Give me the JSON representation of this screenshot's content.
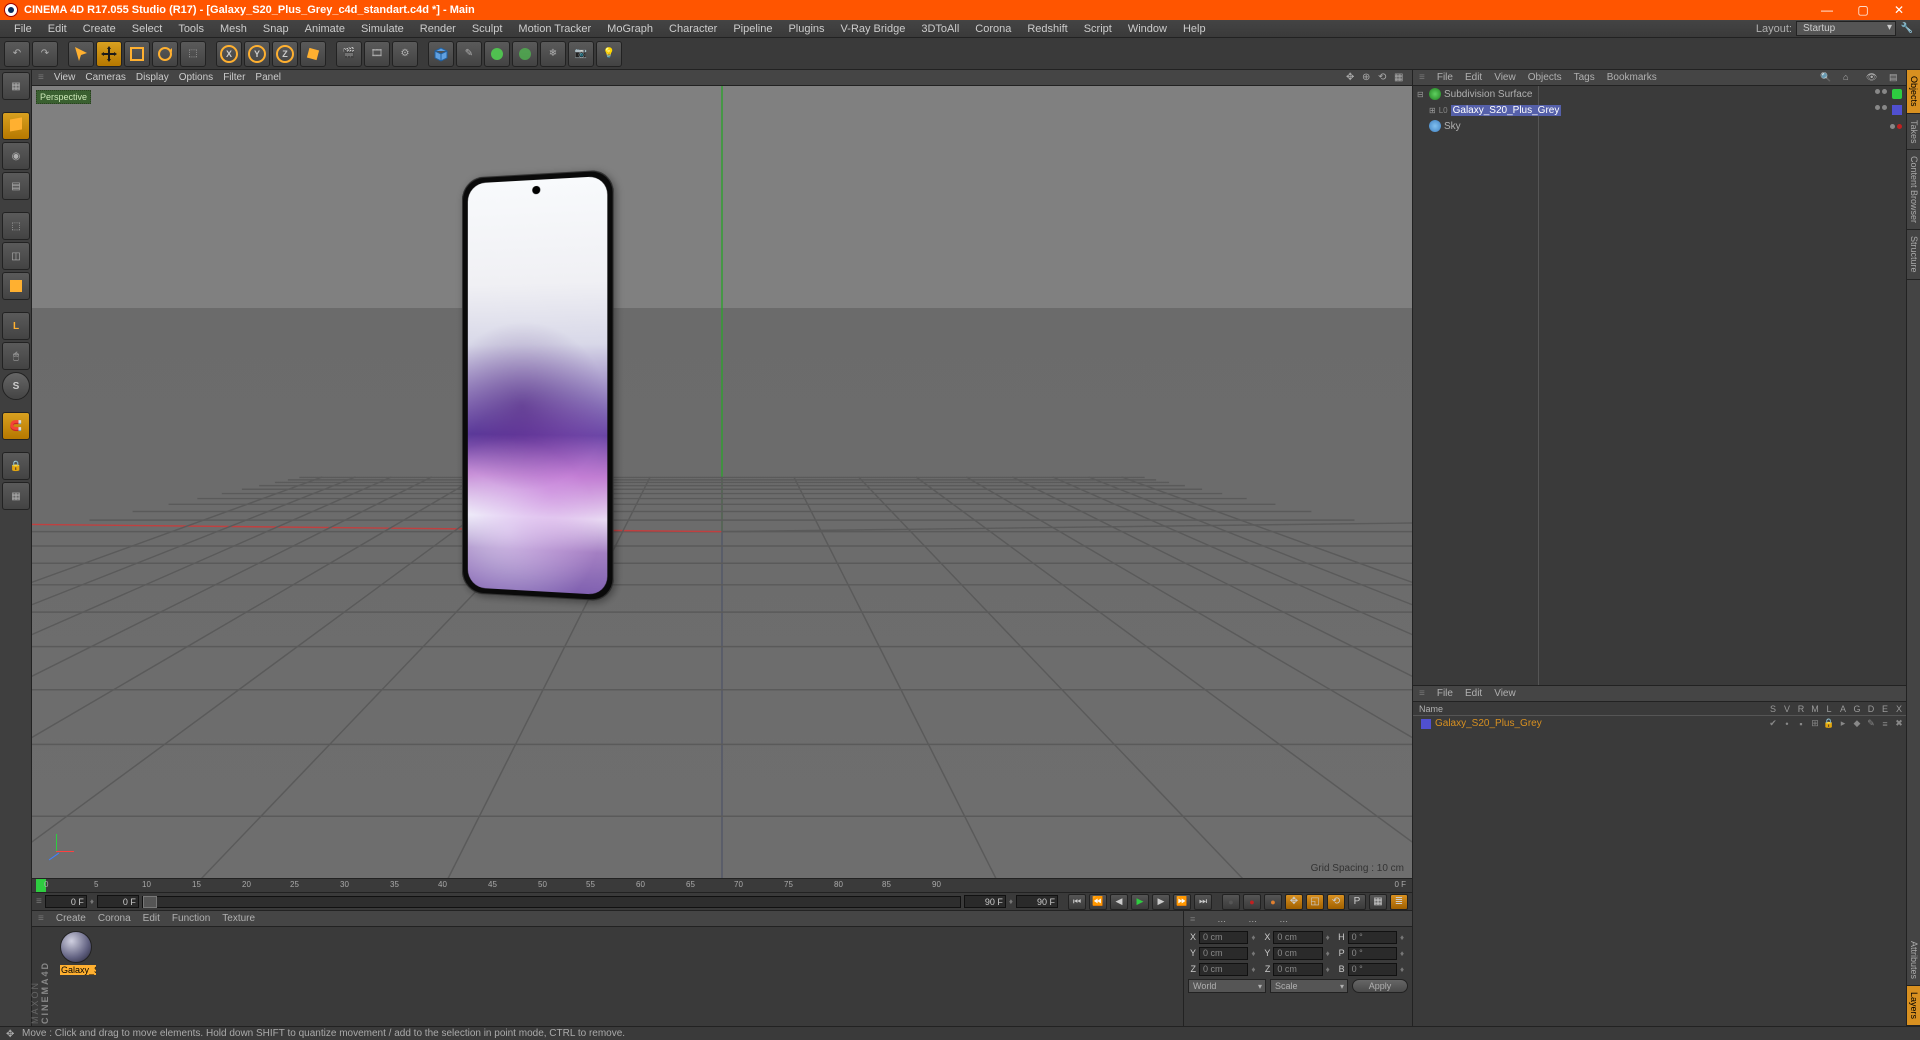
{
  "title": "CINEMA 4D R17.055 Studio (R17) - [Galaxy_S20_Plus_Grey_c4d_standart.c4d *] - Main",
  "layout": {
    "label": "Layout:",
    "value": "Startup"
  },
  "menubar": [
    "File",
    "Edit",
    "Create",
    "Select",
    "Tools",
    "Mesh",
    "Snap",
    "Animate",
    "Simulate",
    "Render",
    "Sculpt",
    "Motion Tracker",
    "MoGraph",
    "Character",
    "Pipeline",
    "Plugins",
    "V-Ray Bridge",
    "3DToAll",
    "Corona",
    "Redshift",
    "Script",
    "Window",
    "Help"
  ],
  "axes": [
    "X",
    "Y",
    "Z"
  ],
  "viewport": {
    "menu": [
      "View",
      "Cameras",
      "Display",
      "Options",
      "Filter",
      "Panel"
    ],
    "label": "Perspective",
    "grid_spacing": "Grid Spacing : 10 cm"
  },
  "timeline": {
    "ticks": [
      "0",
      "5",
      "10",
      "15",
      "20",
      "25",
      "30",
      "35",
      "40",
      "45",
      "50",
      "55",
      "60",
      "65",
      "70",
      "75",
      "80",
      "85",
      "90"
    ],
    "start": "0 F",
    "preview_start": "0 F",
    "preview_end": "90 F",
    "end": "90 F",
    "unit_right": "0 F"
  },
  "object_manager": {
    "menu": [
      "File",
      "Edit",
      "View",
      "Objects",
      "Tags",
      "Bookmarks"
    ],
    "items": [
      {
        "name": "Subdivision Surface",
        "icon": "green",
        "expand": "⊟",
        "indent": 0,
        "selected": false
      },
      {
        "name": "Galaxy_S20_Plus_Grey",
        "icon": "poly",
        "expand": "⊞",
        "indent": 1,
        "selected": true
      },
      {
        "name": "Sky",
        "icon": "sky",
        "expand": "",
        "indent": 0,
        "selected": false
      }
    ]
  },
  "layers": {
    "menu": [
      "File",
      "Edit",
      "View"
    ],
    "columns": [
      "Name",
      "S",
      "V",
      "R",
      "M",
      "L",
      "A",
      "G",
      "D",
      "E",
      "X"
    ],
    "rows": [
      {
        "name": "Galaxy_S20_Plus_Grey",
        "swatch": "#5050d0"
      }
    ]
  },
  "materials": {
    "menu": [
      "Create",
      "Corona",
      "Edit",
      "Function",
      "Texture"
    ],
    "thumb_label": "Galaxy_S"
  },
  "coords": {
    "menu_icons": [
      "≡",
      "…",
      "…",
      "…"
    ],
    "rows": [
      {
        "a": "X",
        "av": "0 cm",
        "b": "X",
        "bv": "0 cm",
        "c": "H",
        "cv": "0 °"
      },
      {
        "a": "Y",
        "av": "0 cm",
        "b": "Y",
        "bv": "0 cm",
        "c": "P",
        "cv": "0 °"
      },
      {
        "a": "Z",
        "av": "0 cm",
        "b": "Z",
        "bv": "0 cm",
        "c": "B",
        "cv": "0 °"
      }
    ],
    "dd1": "World",
    "dd2": "Scale",
    "apply": "Apply"
  },
  "right_tabs_top": [
    "Objects",
    "Takes",
    "Content Browser",
    "Structure"
  ],
  "right_tabs_bottom": [
    "Attributes",
    "Layers"
  ],
  "status": "Move : Click and drag to move elements. Hold down SHIFT to quantize movement / add to the selection in point mode, CTRL to remove.",
  "logo": {
    "brand": "MAXON",
    "product": "CINEMA4D"
  }
}
